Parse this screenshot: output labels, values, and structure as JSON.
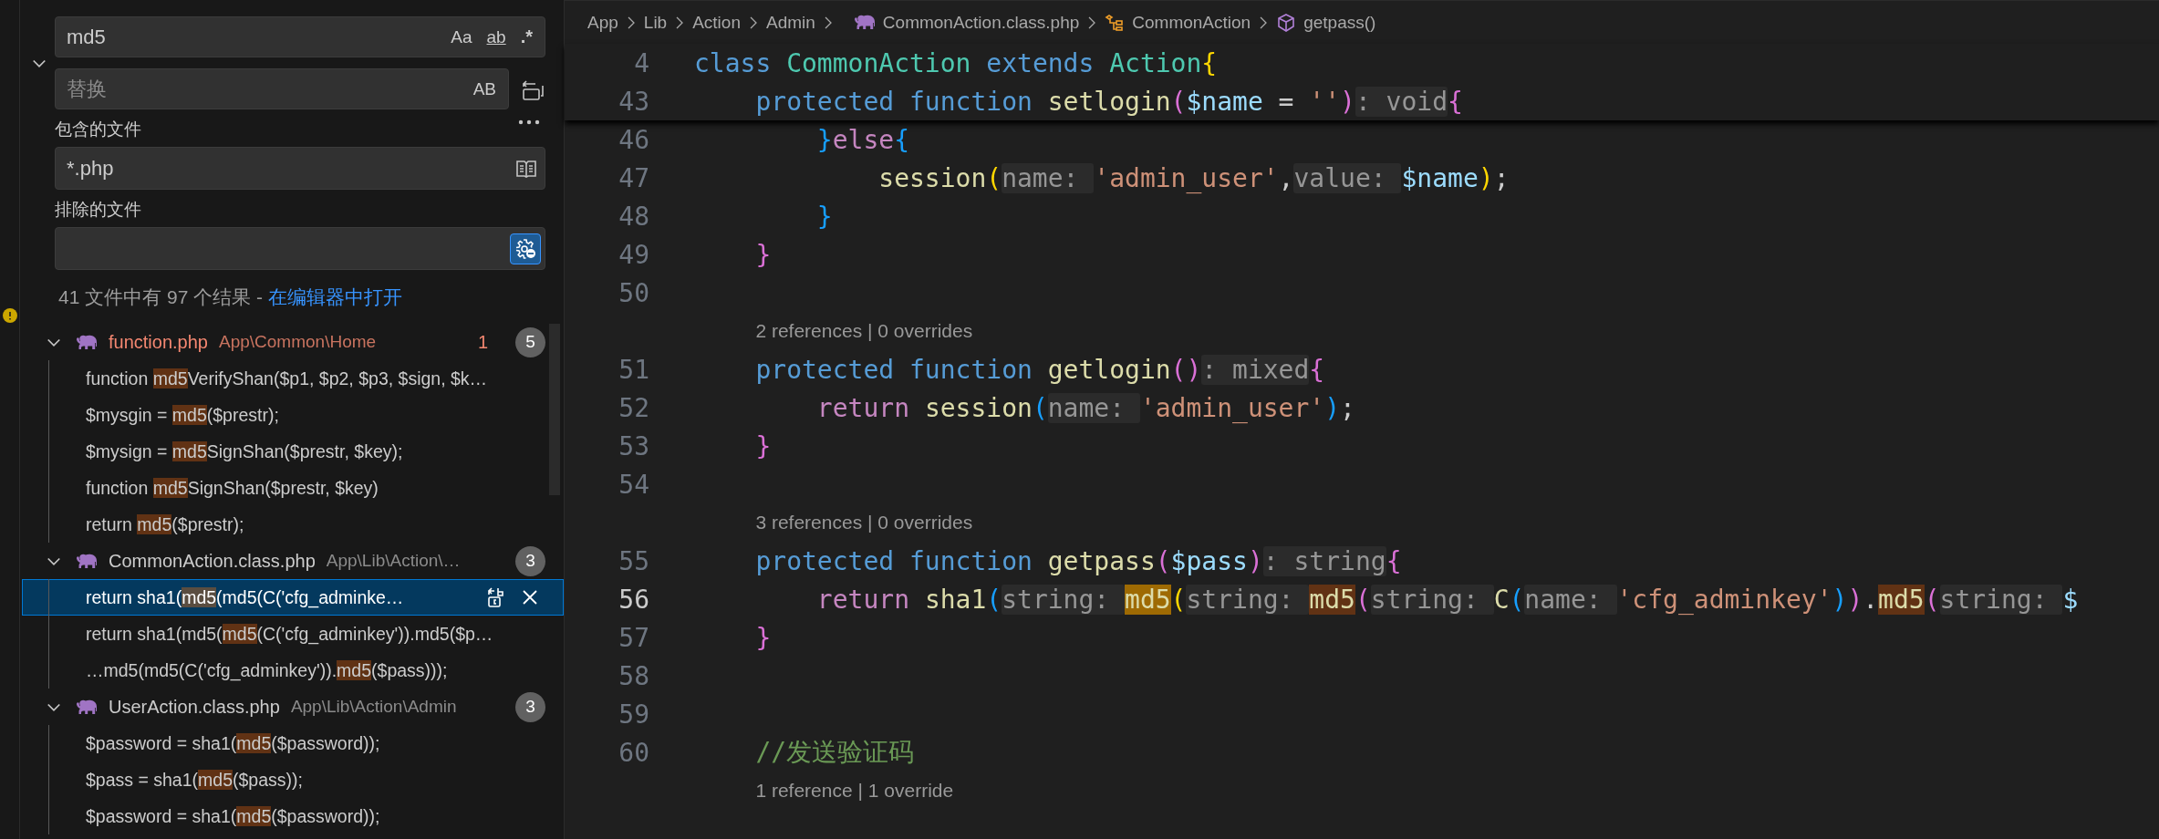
{
  "search": {
    "query": "md5",
    "options": [
      {
        "kind": "case",
        "label": "Aa",
        "on": false
      },
      {
        "kind": "word",
        "label": "ab",
        "on": false
      },
      {
        "kind": "regex",
        "label": ".*",
        "on": false
      }
    ],
    "replace_expanded": true,
    "replace": {
      "placeholder": "替换",
      "preserve_case": {
        "label": "AB",
        "on": false
      }
    },
    "include": {
      "label": "包含的文件",
      "value": "*.php",
      "only_open_editors": false
    },
    "exclude": {
      "label": "排除的文件",
      "use_exclude_settings": true
    },
    "summary": {
      "text": "41 文件中有 97 个结果 - ",
      "link": "在编辑器中打开"
    }
  },
  "results": [
    {
      "file": "function.php",
      "path": "App\\Common\\Home",
      "has_errors": true,
      "problems": "1",
      "count": "5",
      "expanded": true,
      "matches": [
        {
          "pre": "function ",
          "match": "md5",
          "post": "VerifyShan($p1, $p2, $p3, $sign, $k…",
          "selected": false
        },
        {
          "pre": "$mysgin = ",
          "match": "md5",
          "post": "($prestr);",
          "selected": false
        },
        {
          "pre": "$mysign = ",
          "match": "md5",
          "post": "SignShan($prestr, $key);",
          "selected": false
        },
        {
          "pre": "function ",
          "match": "md5",
          "post": "SignShan($prestr, $key)",
          "selected": false
        },
        {
          "pre": "return ",
          "match": "md5",
          "post": "($prestr);",
          "selected": false
        }
      ]
    },
    {
      "file": "CommonAction.class.php",
      "path": "App\\Lib\\Action\\…",
      "has_errors": false,
      "count": "3",
      "expanded": true,
      "matches": [
        {
          "pre": "return sha1(",
          "match": "md5",
          "post": "(md5(C('cfg_adminke…",
          "selected": true
        },
        {
          "pre": "return sha1(md5(",
          "match": "md5",
          "post": "(C('cfg_adminkey')).md5($p…",
          "selected": false
        },
        {
          "pre": "…md5(md5(C('cfg_adminkey')).",
          "match": "md5",
          "post": "($pass)));",
          "selected": false
        }
      ]
    },
    {
      "file": "UserAction.class.php",
      "path": "App\\Lib\\Action\\Admin",
      "has_errors": false,
      "count": "3",
      "expanded": true,
      "matches": [
        {
          "pre": "$password = sha1(",
          "match": "md5",
          "post": "($password));",
          "selected": false
        },
        {
          "pre": "$pass = sha1(",
          "match": "md5",
          "post": "($pass));",
          "selected": false
        },
        {
          "pre": "$password = sha1(",
          "match": "md5",
          "post": "($password));",
          "selected": false
        }
      ]
    }
  ],
  "breadcrumb": [
    {
      "kind": "folder",
      "label": "App"
    },
    {
      "kind": "folder",
      "label": "Lib"
    },
    {
      "kind": "folder",
      "label": "Action"
    },
    {
      "kind": "folder",
      "label": "Admin"
    },
    {
      "kind": "file",
      "label": "CommonAction.class.php"
    },
    {
      "kind": "class",
      "label": "CommonAction"
    },
    {
      "kind": "method",
      "label": "getpass()"
    }
  ],
  "sticky_lines": [
    {
      "num": "4",
      "tokens": [
        {
          "text": "class ",
          "kind": "kw"
        },
        {
          "text": "CommonAction ",
          "kind": "type"
        },
        {
          "text": "extends ",
          "kind": "kw"
        },
        {
          "text": "Action",
          "kind": "type"
        },
        {
          "text": "{",
          "kind": "b1"
        }
      ]
    },
    {
      "num": "43",
      "tokens": [
        {
          "text": "    protected function ",
          "kind": "kw"
        },
        {
          "text": "setlogin",
          "kind": "fn"
        },
        {
          "text": "(",
          "kind": "b2"
        },
        {
          "text": "$name",
          "kind": "var"
        },
        {
          "text": " = ",
          "kind": "plain"
        },
        {
          "text": "''",
          "kind": "str"
        },
        {
          "text": ")",
          "kind": "b2"
        },
        {
          "text": ": void",
          "kind": "hint"
        },
        {
          "text": "{",
          "kind": "b2"
        }
      ]
    }
  ],
  "lines": [
    {
      "kind": "code",
      "num": "46",
      "current": false,
      "tokens": [
        {
          "text": "        }",
          "kind": "b3"
        },
        {
          "text": "else",
          "kind": "ctrl"
        },
        {
          "text": "{",
          "kind": "b3"
        }
      ]
    },
    {
      "kind": "code",
      "num": "47",
      "current": false,
      "tokens": [
        {
          "text": "            session",
          "kind": "fn"
        },
        {
          "text": "(",
          "kind": "b1"
        },
        {
          "text": "name: ",
          "kind": "hint"
        },
        {
          "text": "'admin_user'",
          "kind": "str"
        },
        {
          "text": ",",
          "kind": "plain"
        },
        {
          "text": "value: ",
          "kind": "hint"
        },
        {
          "text": "$name",
          "kind": "var"
        },
        {
          "text": ")",
          "kind": "b1"
        },
        {
          "text": ";",
          "kind": "plain"
        }
      ]
    },
    {
      "kind": "code",
      "num": "48",
      "current": false,
      "tokens": [
        {
          "text": "        }",
          "kind": "b3"
        }
      ]
    },
    {
      "kind": "code",
      "num": "49",
      "current": false,
      "tokens": [
        {
          "text": "    }",
          "kind": "b2"
        }
      ]
    },
    {
      "kind": "code",
      "num": "50",
      "current": false
    },
    {
      "kind": "lens",
      "text": "2 references | 0 overrides"
    },
    {
      "kind": "code",
      "num": "51",
      "current": false,
      "tokens": [
        {
          "text": "    protected function ",
          "kind": "kw"
        },
        {
          "text": "getlogin",
          "kind": "fn"
        },
        {
          "text": "()",
          "kind": "b2"
        },
        {
          "text": ": mixed",
          "kind": "hint"
        },
        {
          "text": "{",
          "kind": "b2"
        }
      ]
    },
    {
      "kind": "code",
      "num": "52",
      "current": false,
      "tokens": [
        {
          "text": "        return ",
          "kind": "ctrl"
        },
        {
          "text": "session",
          "kind": "fn"
        },
        {
          "text": "(",
          "kind": "b3"
        },
        {
          "text": "name: ",
          "kind": "hint"
        },
        {
          "text": "'admin_user'",
          "kind": "str"
        },
        {
          "text": ")",
          "kind": "b3"
        },
        {
          "text": ";",
          "kind": "plain"
        }
      ]
    },
    {
      "kind": "code",
      "num": "53",
      "current": false,
      "tokens": [
        {
          "text": "    }",
          "kind": "b2"
        }
      ]
    },
    {
      "kind": "code",
      "num": "54",
      "current": false
    },
    {
      "kind": "lens",
      "text": "3 references | 0 overrides"
    },
    {
      "kind": "code",
      "num": "55",
      "current": false,
      "tokens": [
        {
          "text": "    protected function ",
          "kind": "kw"
        },
        {
          "text": "getpass",
          "kind": "fn"
        },
        {
          "text": "(",
          "kind": "b2"
        },
        {
          "text": "$pass",
          "kind": "var"
        },
        {
          "text": ")",
          "kind": "b2"
        },
        {
          "text": ": string",
          "kind": "hint"
        },
        {
          "text": "{",
          "kind": "b2"
        }
      ]
    },
    {
      "kind": "code",
      "num": "56",
      "current": true,
      "tokens": [
        {
          "text": "        return ",
          "kind": "ctrl"
        },
        {
          "text": "sha1",
          "kind": "fn"
        },
        {
          "text": "(",
          "kind": "b3"
        },
        {
          "text": "string: ",
          "kind": "hint"
        },
        {
          "text": "md5",
          "kind": "cur"
        },
        {
          "text": "(",
          "kind": "b1"
        },
        {
          "text": "string: ",
          "kind": "hint"
        },
        {
          "text": "md5",
          "kind": "match"
        },
        {
          "text": "(",
          "kind": "b2"
        },
        {
          "text": "string: ",
          "kind": "hint"
        },
        {
          "text": "C",
          "kind": "fn"
        },
        {
          "text": "(",
          "kind": "b3"
        },
        {
          "text": "name: ",
          "kind": "hint"
        },
        {
          "text": "'cfg_adminkey'",
          "kind": "str"
        },
        {
          "text": ")",
          "kind": "b3"
        },
        {
          "text": ")",
          "kind": "b2"
        },
        {
          "text": ".",
          "kind": "plain"
        },
        {
          "text": "md5",
          "kind": "match"
        },
        {
          "text": "(",
          "kind": "b2"
        },
        {
          "text": "string: ",
          "kind": "hint"
        },
        {
          "text": "$",
          "kind": "var"
        }
      ]
    },
    {
      "kind": "code",
      "num": "57",
      "current": false,
      "tokens": [
        {
          "text": "    }",
          "kind": "b2"
        }
      ]
    },
    {
      "kind": "code",
      "num": "58",
      "current": false
    },
    {
      "kind": "code",
      "num": "59",
      "current": false
    },
    {
      "kind": "code",
      "num": "60",
      "current": false,
      "tokens": [
        {
          "text": "    //发送验证码",
          "kind": "cmt"
        }
      ]
    },
    {
      "kind": "lens",
      "text": "1 reference | 1 override"
    }
  ]
}
